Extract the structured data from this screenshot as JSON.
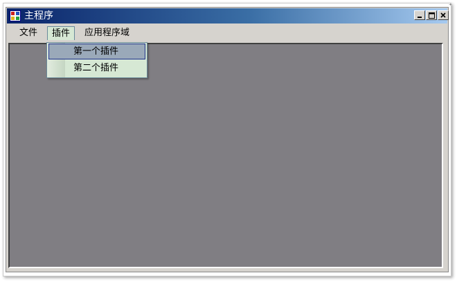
{
  "window": {
    "title": "主程序",
    "controls": {
      "minimize": "minimize",
      "maximize": "maximize",
      "close": "close"
    }
  },
  "menubar": {
    "items": [
      {
        "label": "文件"
      },
      {
        "label": "插件"
      },
      {
        "label": "应用程序域"
      }
    ]
  },
  "dropdown": {
    "parent": "插件",
    "items": [
      {
        "label": "第一个插件",
        "highlighted": true
      },
      {
        "label": "第二个插件",
        "highlighted": false
      }
    ]
  },
  "colors": {
    "titlebar_start": "#0a246a",
    "titlebar_end": "#a6caf0",
    "client_area": "#807e83",
    "menu_background": "#d6e8d4",
    "menu_highlight": "#9aa9b9",
    "window_face": "#d6d3ce"
  },
  "icons": {
    "app": "app-window-icon",
    "minimize": "minimize-icon",
    "maximize": "maximize-icon",
    "close": "close-icon"
  }
}
